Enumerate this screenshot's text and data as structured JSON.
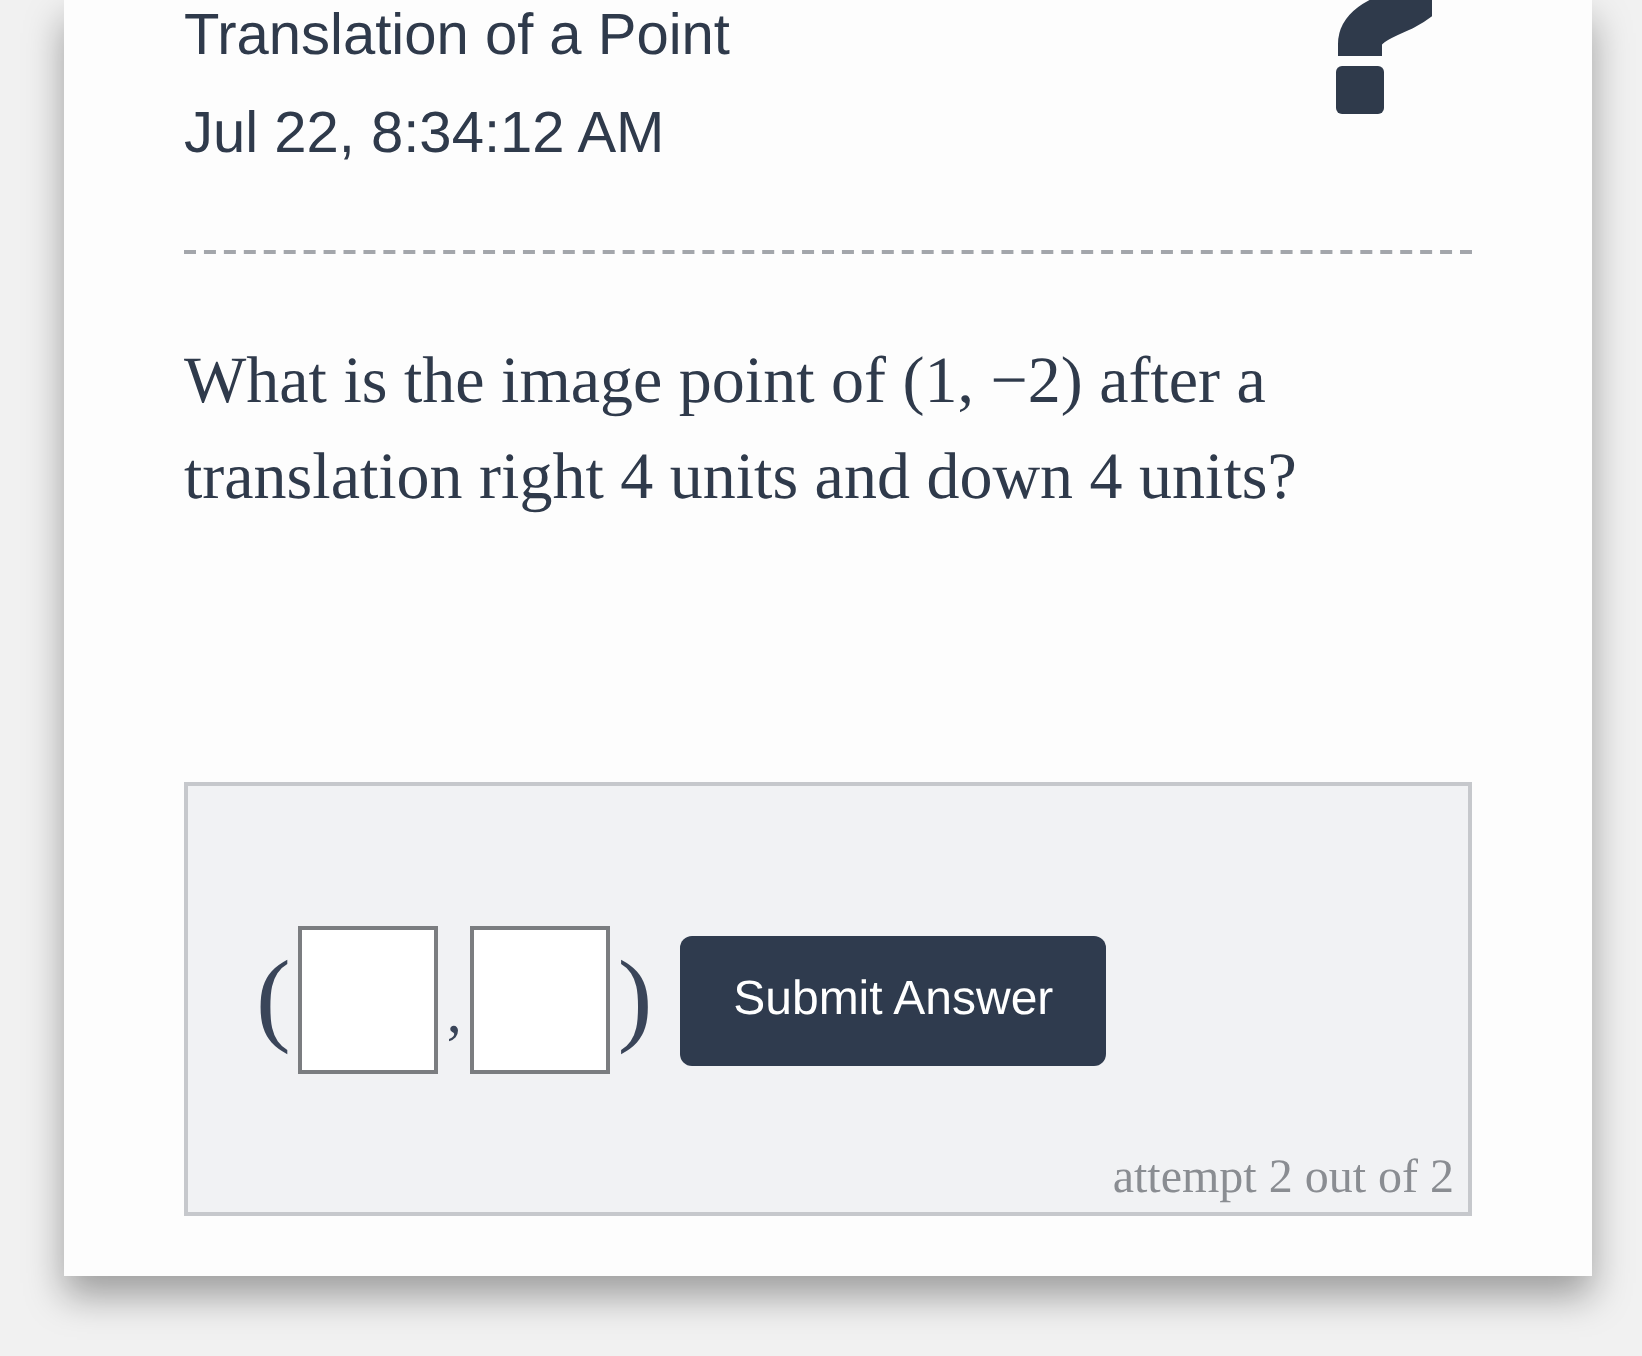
{
  "header": {
    "title": "Translation of a Point",
    "timestamp": "Jul 22, 8:34:12 AM"
  },
  "question": {
    "text": "What is the image point of (1, −2) after a translation right 4 units and down 4 units?"
  },
  "answer": {
    "parts": [
      {
        "kind": "text",
        "text": "("
      },
      {
        "kind": "input"
      },
      {
        "kind": "separator",
        "text": ","
      },
      {
        "kind": "input"
      },
      {
        "kind": "text",
        "text": ")"
      }
    ],
    "submit_button": "Submit Answer",
    "attempts": "attempt 2 out of 2"
  }
}
